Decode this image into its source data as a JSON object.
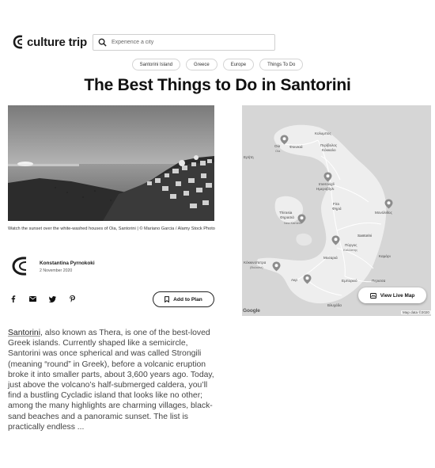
{
  "brand": {
    "name": "culture trip"
  },
  "search": {
    "placeholder": "Experience a city"
  },
  "tags": [
    "Santorini Island",
    "Greece",
    "Europe",
    "Things To Do"
  ],
  "page_title": "The Best Things to Do in Santorini",
  "hero": {
    "caption": "Watch the sunset over the white-washed houses of Oia, Santorini | © Mariano Garcia / Alamy Stock Photo"
  },
  "author": {
    "name": "Konstantina Pyrnokoki",
    "date": "2 November 2020"
  },
  "share": {
    "icons": [
      "facebook-icon",
      "email-icon",
      "twitter-icon",
      "pinterest-icon"
    ]
  },
  "add_to_plan": {
    "label": "Add to Plan"
  },
  "map": {
    "view_live_label": "View Live Map",
    "google": "Google",
    "credit": "Map data ©2020",
    "labels": {
      "kolympos": "Κολυμπος",
      "oia_gr": "Οία",
      "oia": "Oia",
      "foinikia": "Φοινικιά",
      "finikia": "Finikia",
      "perivolos_north": "Περίβολος",
      "kokkalo": "Κόκκαλο",
      "ireti": "Ερήτη",
      "imerovigli": "Imerovigli",
      "imerovigli_gr": "Ημεροβίγλι",
      "fira": "Fira",
      "fira_gr": "Φηρά",
      "thirasia": "Thirasia",
      "thirasia_gr": "Θηρασιά",
      "nea_kameni": "Nea Kameni",
      "monolithos": "Μονόλιθος",
      "santorini": "Santorini",
      "pyrgos": "Πύργος",
      "pyrgos_lat": "Καλλίστης",
      "kamari": "Καμάρι",
      "mesaria": "Μεσαριά",
      "kokkinopetra": "Κόκκινοπετρα",
      "volkan": "(Βολκάνι)",
      "akrotiri": "Ακρ",
      "emporio": "Εμπορειό",
      "perissa": "Περισσα",
      "vlychada": "Βλυχάδα"
    }
  },
  "article": {
    "lead": "Santorini",
    "body": ", also known as Thera, is one of the best-loved Greek islands. Currently shaped like a semicircle, Santorini was once spherical and was called Strongili (meaning “round” in Greek), before a volcanic eruption broke it into smaller parts, about 3,600 years ago. Today, just above the volcano’s half-submerged caldera, you’ll find a bustling Cycladic island that looks like no other; among the many highlights are charming villages, black-sand beaches and a panoramic sunset. The list is practically endless ..."
  },
  "colors": {
    "text": "#1a1a1a",
    "map_water": "#d6d6d6",
    "map_land": "#eeeeee",
    "border": "#d4d4d4"
  }
}
